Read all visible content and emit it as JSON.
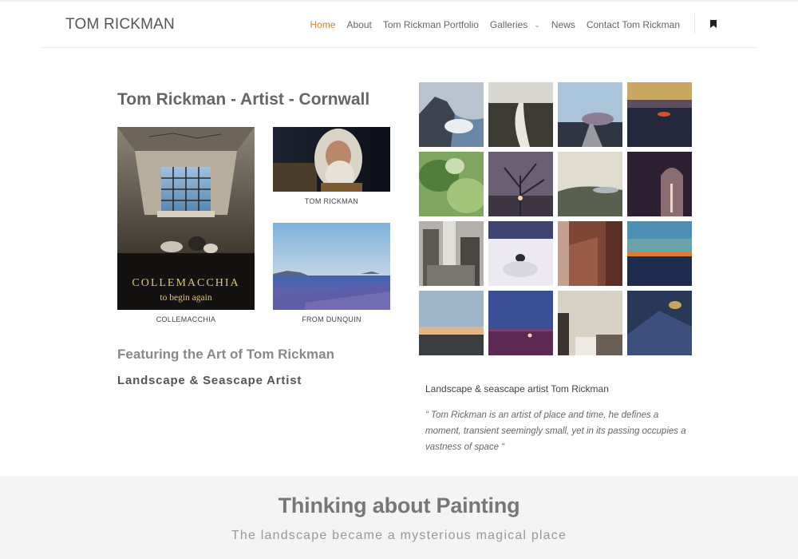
{
  "site": {
    "logo": "TOM RICKMAN"
  },
  "nav": {
    "items": [
      {
        "label": "Home",
        "active": true
      },
      {
        "label": "About"
      },
      {
        "label": "Tom Rickman Portfolio"
      },
      {
        "label": "Galleries",
        "has_dropdown": true
      },
      {
        "label": "News"
      },
      {
        "label": "Contact Tom Rickman"
      }
    ],
    "bookmark_icon": "bookmark-icon",
    "dropdown_icon": "chevron-down-icon",
    "accent_color": "#d4812c"
  },
  "main": {
    "title": "Tom Rickman - Artist - Cornwall",
    "cards": {
      "book": {
        "cover_title": "COLLEMACCHIA",
        "cover_subtitle": "to begin again",
        "caption": "COLLEMACCHIA"
      },
      "portrait": {
        "caption": "TOM RICKMAN"
      },
      "dunquin": {
        "caption": "FROM DUNQUIN"
      }
    },
    "featuring": "Featuring the Art of Tom Rickman",
    "subtitle": "Landscape & Seascape Artist"
  },
  "gallery": {
    "tile_count": 16
  },
  "about": {
    "description": "Landscape & seascape artist Tom Rickman",
    "quote": "“ Tom Rickman is an artist of place and time, he defines a moment, transient seemingly small, yet in its passing occupies a vastness of space “"
  },
  "band": {
    "title": "Thinking about Painting",
    "subtitle": "The landscape became a mysterious magical place"
  }
}
